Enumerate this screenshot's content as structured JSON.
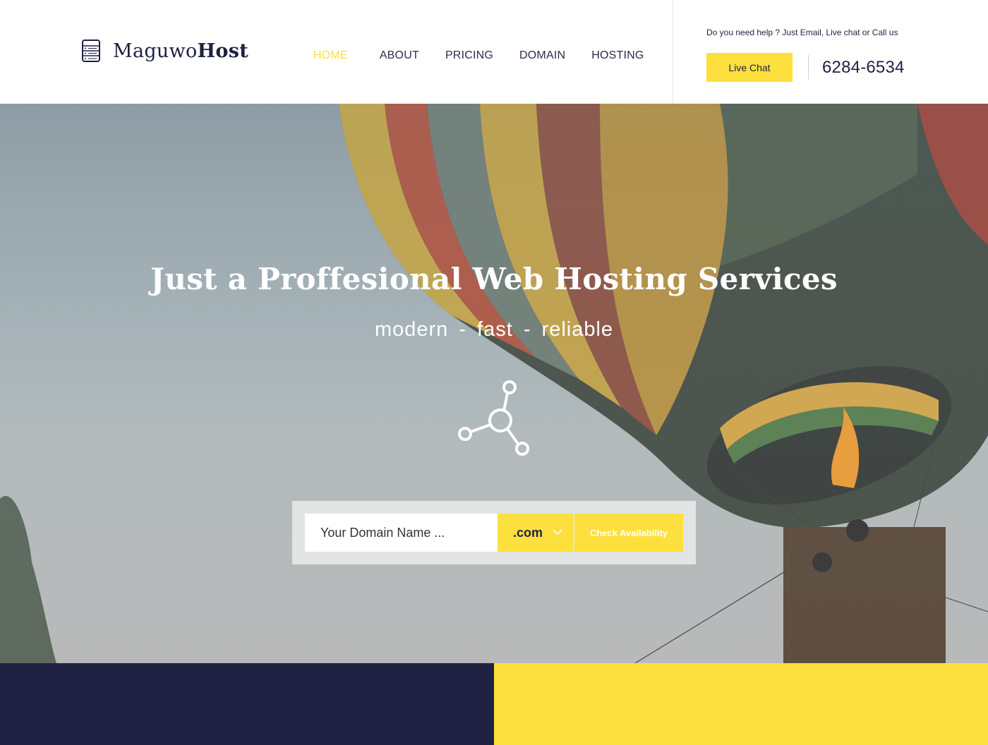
{
  "brand": {
    "name_regular": "Maguwo",
    "name_bold": "Host"
  },
  "nav": {
    "items": [
      {
        "label": "HOME",
        "active": true
      },
      {
        "label": "ABOUT",
        "active": false
      },
      {
        "label": "PRICING",
        "active": false
      },
      {
        "label": "DOMAIN",
        "active": false
      },
      {
        "label": "HOSTING",
        "active": false
      }
    ]
  },
  "contact": {
    "help_text": "Do you need help ? Just Email, Live chat or Call us",
    "live_chat_label": "Live Chat",
    "phone": "6284-6534"
  },
  "hero": {
    "title": "Just a Proffesional Web Hosting Services",
    "subtitle": "modern  -  fast  -  reliable",
    "icon": "share-network-icon"
  },
  "domain_search": {
    "placeholder": "Your Domain Name ...",
    "value": "",
    "tld_selected": ".com",
    "button_label": "Check Availability"
  },
  "colors": {
    "accent": "#fde03e",
    "navy": "#202142",
    "text": "#1f2142"
  }
}
